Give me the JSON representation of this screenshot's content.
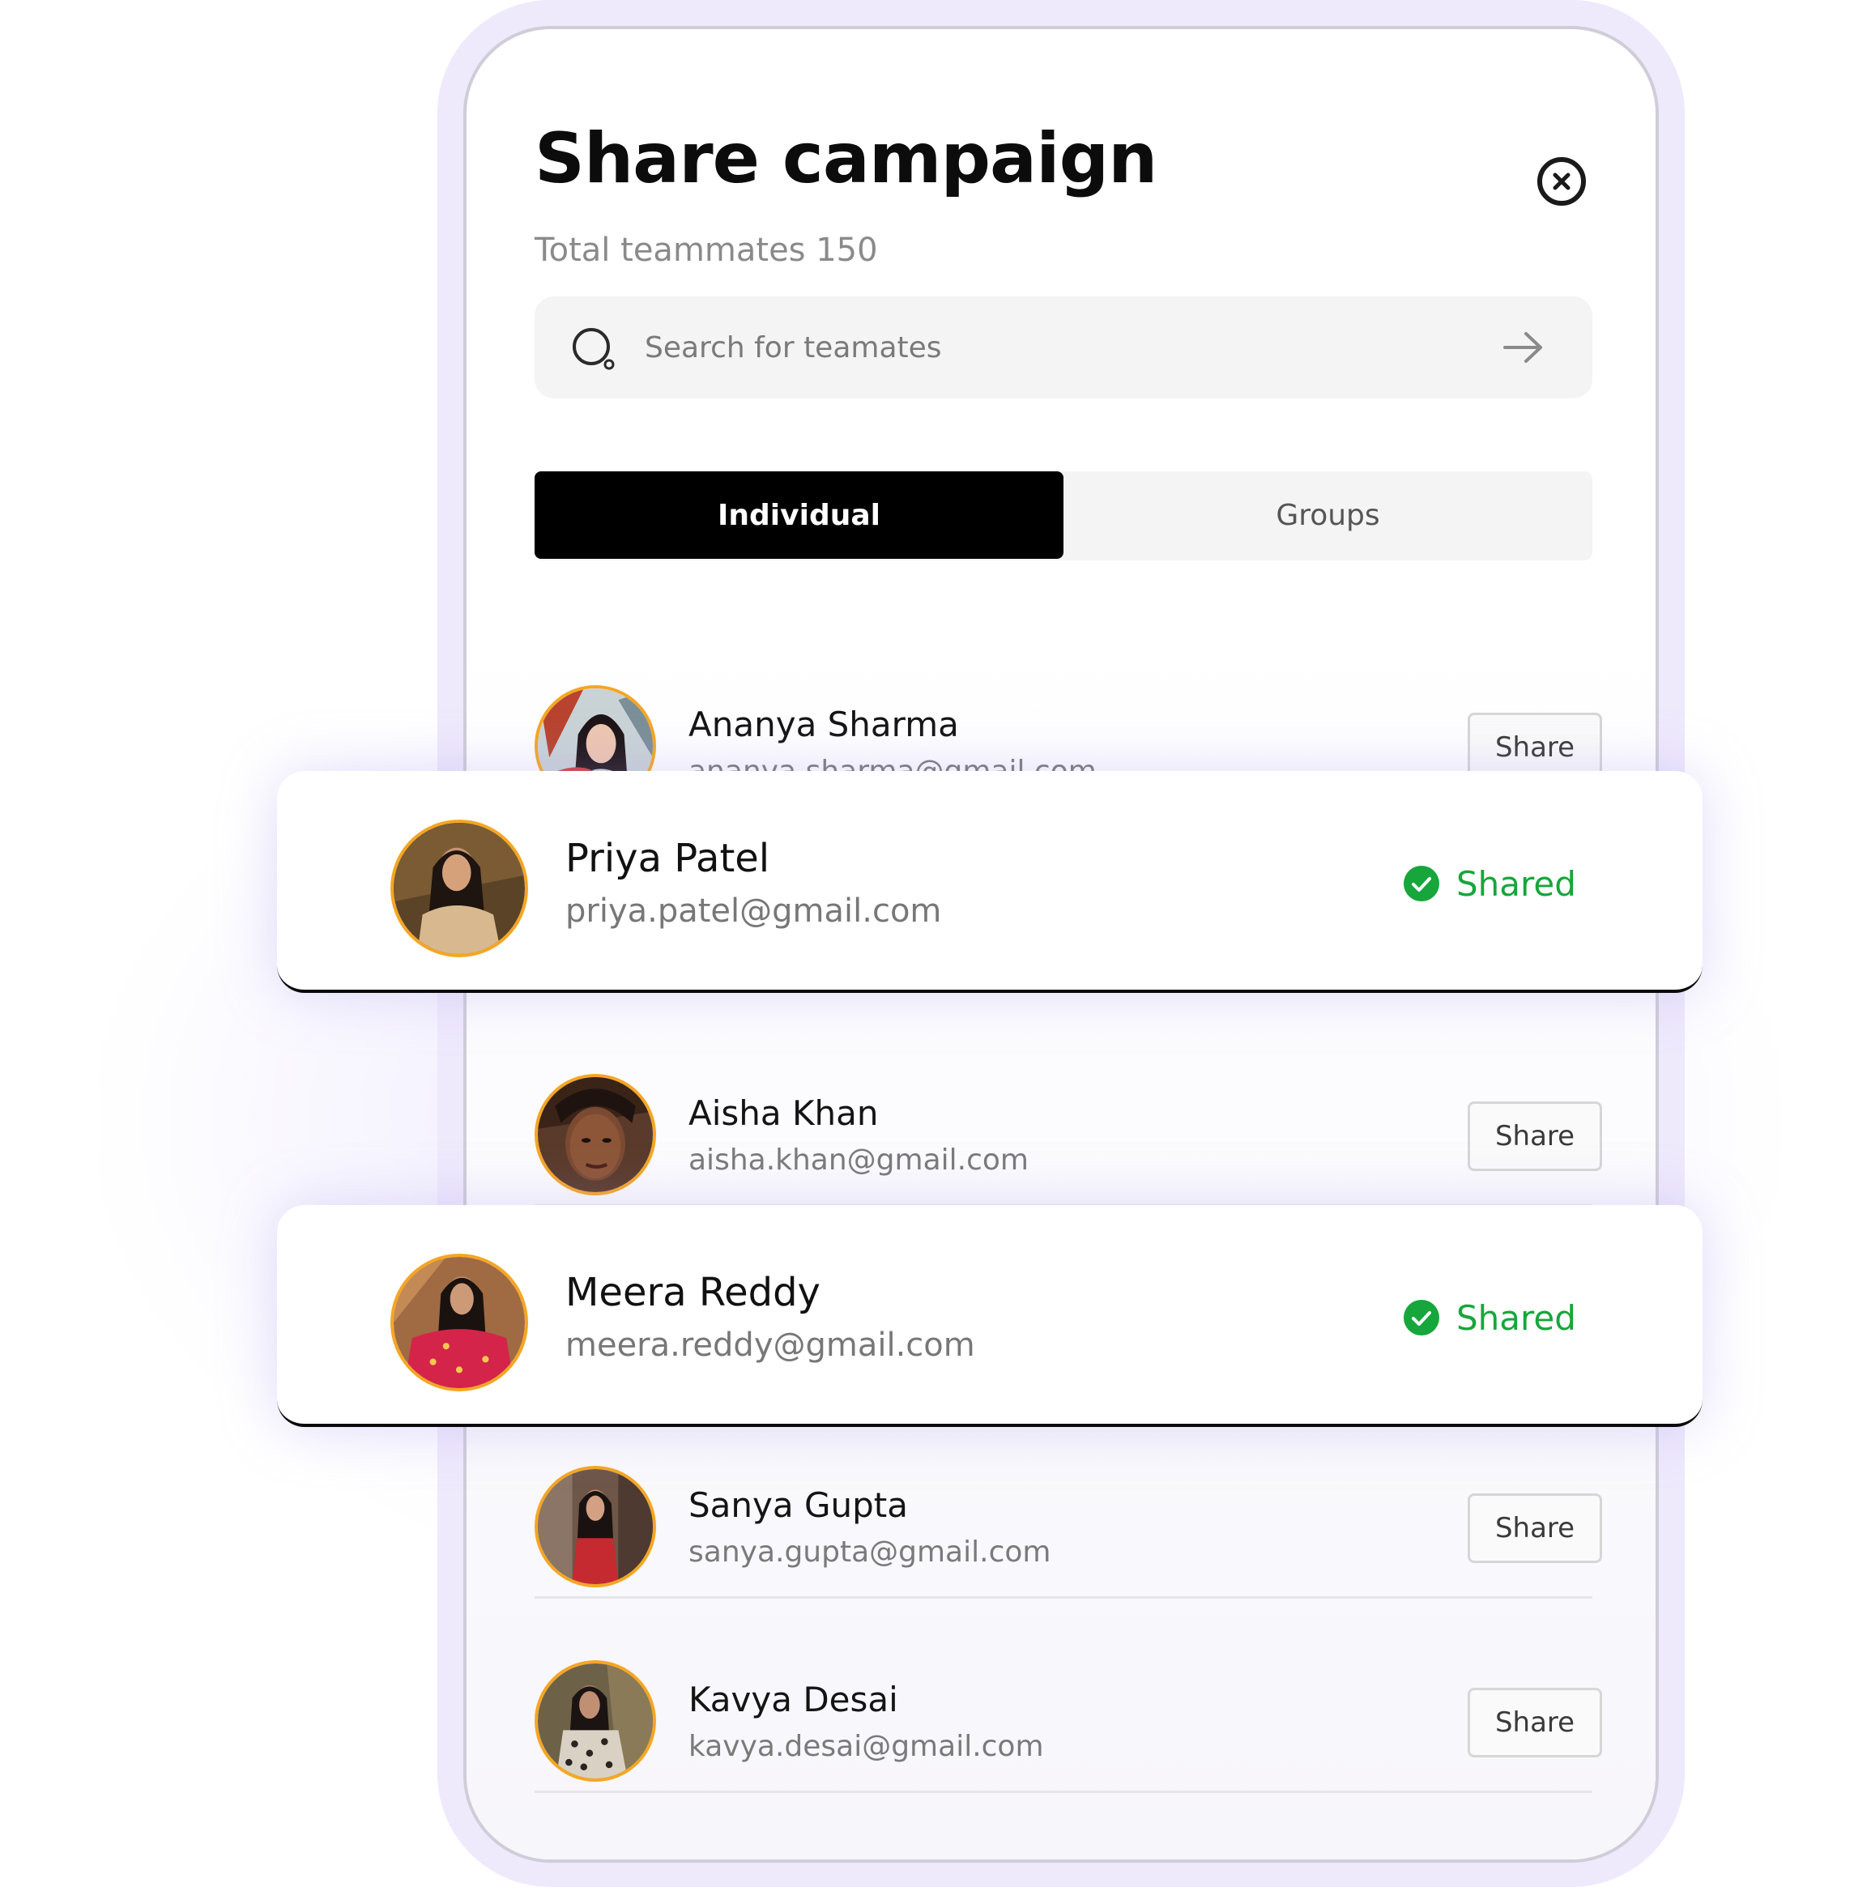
{
  "modal": {
    "title": "Share campaign",
    "subtitle": "Total teammates 150",
    "close_icon": "close-circle-icon"
  },
  "search": {
    "placeholder": "Search for teamates",
    "value": "",
    "icon": "search-icon",
    "submit_icon": "arrow-right-icon"
  },
  "tabs": [
    {
      "label": "Individual",
      "active": true
    },
    {
      "label": "Groups",
      "active": false
    }
  ],
  "teammates": [
    {
      "name": "Ananya Sharma",
      "email": "ananya.sharma@gmail.com",
      "status": "share",
      "action_label": "Share"
    },
    {
      "name": "Priya Patel",
      "email": "priya.patel@gmail.com",
      "status": "shared",
      "action_label": "Shared"
    },
    {
      "name": "Aisha Khan",
      "email": "aisha.khan@gmail.com",
      "status": "share",
      "action_label": "Share"
    },
    {
      "name": "Meera Reddy",
      "email": "meera.reddy@gmail.com",
      "status": "shared",
      "action_label": "Shared"
    },
    {
      "name": "Sanya Gupta",
      "email": "sanya.gupta@gmail.com",
      "status": "share",
      "action_label": "Share"
    },
    {
      "name": "Kavya Desai",
      "email": "kavya.desai@gmail.com",
      "status": "share",
      "action_label": "Share"
    }
  ],
  "colors": {
    "shared_green": "#17a63b",
    "avatar_ring": "#f5a623",
    "frame_lavender": "#efe9fc",
    "active_tab": "#000000"
  }
}
